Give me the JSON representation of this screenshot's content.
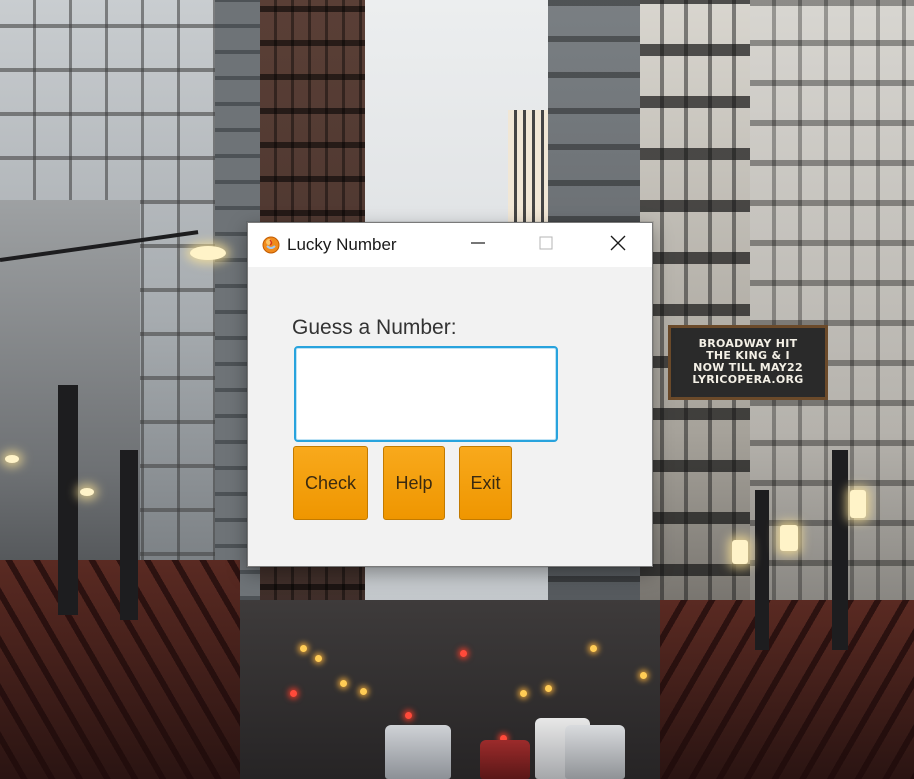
{
  "window": {
    "title": "Lucky Number",
    "app_icon": "java-cup-icon",
    "controls": {
      "minimize_icon": "minimize-icon",
      "maximize_icon": "maximize-icon",
      "close_icon": "close-icon"
    }
  },
  "form": {
    "prompt": "Guess a Number:",
    "input_value": "",
    "input_placeholder": ""
  },
  "buttons": {
    "check_label": "Check",
    "help_label": "Help",
    "exit_label": "Exit"
  },
  "wallpaper": {
    "marquee_lines": [
      "BROADWAY HIT",
      "THE KING & I",
      "NOW TILL MAY22",
      "LYRICOPERA.ORG"
    ]
  },
  "colors": {
    "button_accent": "#f39c12",
    "input_focus_border": "#28a3dd",
    "window_background": "#f2f2f2",
    "titlebar_background": "#ffffff"
  }
}
